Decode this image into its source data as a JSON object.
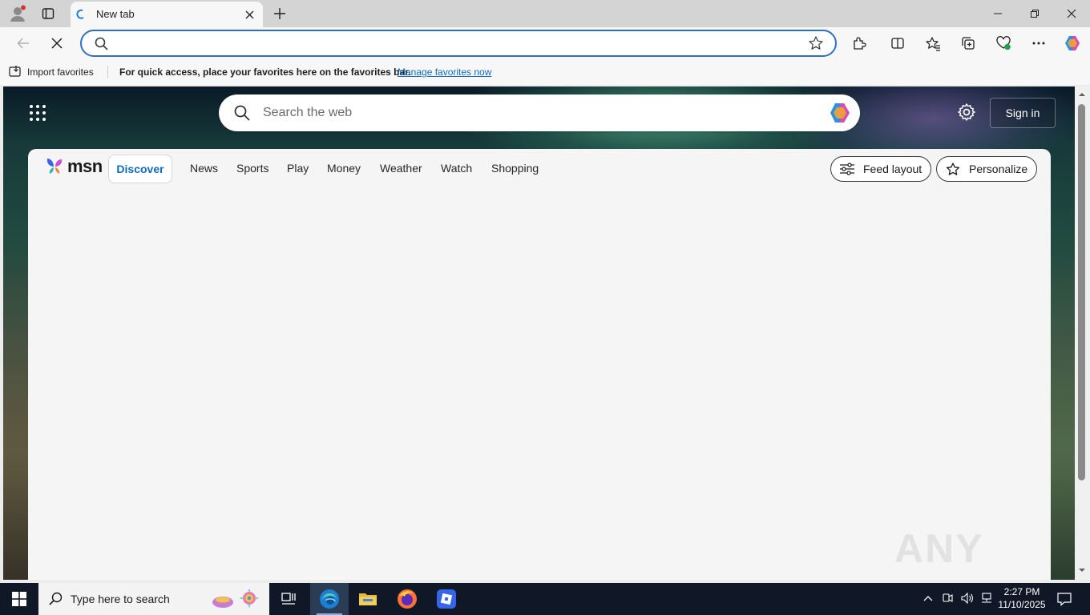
{
  "browser": {
    "tab": {
      "title": "New tab"
    },
    "omnibox": {
      "value": "",
      "placeholder": ""
    },
    "favorites_bar": {
      "import_label": "Import favorites",
      "hint": "For quick access, place your favorites here on the favorites bar.",
      "manage_link": "Manage favorites now"
    }
  },
  "msn": {
    "search_placeholder": "Search the web",
    "sign_in": "Sign in",
    "logo_text": "msn",
    "nav": {
      "discover": "Discover",
      "items": [
        "News",
        "Sports",
        "Play",
        "Money",
        "Weather",
        "Watch",
        "Shopping"
      ]
    },
    "feed_layout": "Feed layout",
    "personalize": "Personalize"
  },
  "watermark": "ANY RUN",
  "taskbar": {
    "search_placeholder": "Type here to search",
    "time": "2:27 PM",
    "date": "11/10/2025"
  },
  "colors": {
    "accent": "#0f6cbd",
    "omnibox_border": "#2f6fbf",
    "taskbar": "#101827"
  },
  "icons": [
    "profile-icon",
    "tab-actions-icon",
    "edge-tab-icon",
    "close-tab-icon",
    "new-tab-icon",
    "minimize-icon",
    "restore-icon",
    "window-close-icon",
    "back-icon",
    "stop-loading-icon",
    "search-icon",
    "star-icon",
    "extensions-icon",
    "split-screen-icon",
    "favorites-icon",
    "collections-icon",
    "browser-essentials-icon",
    "more-icon",
    "copilot-icon",
    "apps-grid-icon",
    "settings-gear-icon",
    "windows-start-icon",
    "task-view-icon",
    "edge-icon",
    "file-explorer-icon",
    "firefox-icon",
    "roblox-icon"
  ]
}
